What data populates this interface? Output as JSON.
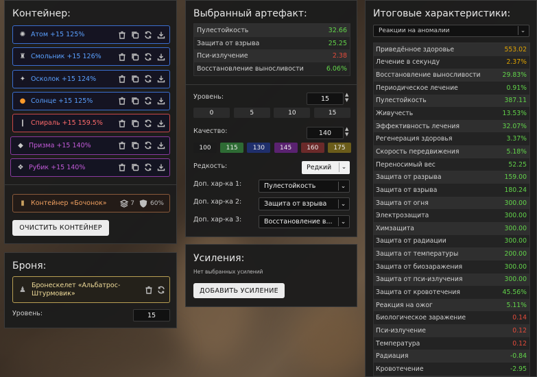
{
  "colors": {
    "green": "#62d44a",
    "orange": "#e0a400",
    "red": "#e34b3b",
    "white": "#ffffff"
  },
  "container": {
    "title": "Контейнер:",
    "artifacts": [
      {
        "name": "Атом +15 125%",
        "color": "#5aa0ff",
        "border": "#3b6fd1",
        "icon": "atom-icon",
        "glyph": "✺"
      },
      {
        "name": "Смольник +15 126%",
        "color": "#5aa0ff",
        "border": "#3b6fd1",
        "icon": "smolnik-icon",
        "glyph": "♜"
      },
      {
        "name": "Осколок +15 124%",
        "color": "#5aa0ff",
        "border": "#3b6fd1",
        "icon": "oskolok-icon",
        "glyph": "✦"
      },
      {
        "name": "Солнце +15 125%",
        "color": "#5aa0ff",
        "border": "#3b6fd1",
        "icon": "sun-icon",
        "glyph": "●"
      },
      {
        "name": "Спираль +15 159.5%",
        "color": "#ff6b6b",
        "border": "#c94848",
        "icon": "spiral-icon",
        "glyph": "❙"
      },
      {
        "name": "Призма +15 140%",
        "color": "#c15ad8",
        "border": "#8a3aa0",
        "icon": "prism-icon",
        "glyph": "◆"
      },
      {
        "name": "Рубик +15 140%",
        "color": "#c15ad8",
        "border": "#8a3aa0",
        "icon": "rubik-icon",
        "glyph": "❖"
      }
    ],
    "container_item": {
      "name": "Контейнер «Бочонок»",
      "slots": "7",
      "protection": "60%"
    },
    "clear_button": "ОЧИСТИТЬ КОНТЕЙНЕР"
  },
  "armor": {
    "title": "Броня:",
    "item_line1": "Бронескелет «Альбатрос-",
    "item_line2": "Штурмовик»",
    "level_label": "Уровень:",
    "level_value": "15"
  },
  "artifact": {
    "title": "Выбранный артефакт:",
    "stats": [
      {
        "name": "Пулестойкость",
        "value": "32.66",
        "color": "#62d44a"
      },
      {
        "name": "Защита от взрыва",
        "value": "25.25",
        "color": "#62d44a"
      },
      {
        "name": "Пси-излучение",
        "value": "2.38",
        "color": "#e34b3b"
      },
      {
        "name": "Восстановление выносливости",
        "value": "6.06%",
        "color": "#62d44a"
      }
    ],
    "level_label": "Уровень:",
    "level_value": "15",
    "level_presets": [
      "0",
      "5",
      "10",
      "15"
    ],
    "quality_label": "Качество:",
    "quality_value": "140",
    "quality_presets": [
      {
        "label": "100",
        "bg": "#1b1b1b"
      },
      {
        "label": "115",
        "bg": "#2e6b34"
      },
      {
        "label": "130",
        "bg": "#1f2f6b"
      },
      {
        "label": "145",
        "bg": "#5a2270"
      },
      {
        "label": "160",
        "bg": "#6b2a2a"
      },
      {
        "label": "175",
        "bg": "#6b5c1a"
      }
    ],
    "rarity_label": "Редкость:",
    "rarity_value": "Редкий",
    "extra1_label": "Доп. хар-ка 1:",
    "extra1_value": "Пулестойкость",
    "extra2_label": "Доп. хар-ка 2:",
    "extra2_value": "Защита от взрыва",
    "extra3_label": "Доп. хар-ка 3:",
    "extra3_value": "Восстановление в..."
  },
  "upgrades": {
    "title": "Усиления:",
    "empty_text": "Нет выбранных усилений",
    "add_button": "ДОБАВИТЬ УСИЛЕНИЕ"
  },
  "totals": {
    "title": "Итоговые характеристики:",
    "filter_value": "Реакции на аномалии",
    "rows": [
      {
        "name": "Приведённое здоровье",
        "value": "553.02",
        "color": "#e0a400"
      },
      {
        "name": "Лечение в секунду",
        "value": "2.37%",
        "color": "#e0a400"
      },
      {
        "name": "Восстановление выносливости",
        "value": "29.83%",
        "color": "#62d44a"
      },
      {
        "name": "Периодическое лечение",
        "value": "0.91%",
        "color": "#62d44a"
      },
      {
        "name": "Пулестойкость",
        "value": "387.11",
        "color": "#62d44a"
      },
      {
        "name": "Живучесть",
        "value": "13.53%",
        "color": "#62d44a"
      },
      {
        "name": "Эффективность лечения",
        "value": "32.07%",
        "color": "#62d44a"
      },
      {
        "name": "Регенерация здоровья",
        "value": "3.37%",
        "color": "#62d44a"
      },
      {
        "name": "Скорость передвижения",
        "value": "5.18%",
        "color": "#62d44a"
      },
      {
        "name": "Переносимый вес",
        "value": "52.25",
        "color": "#62d44a"
      },
      {
        "name": "Защита от разрыва",
        "value": "159.00",
        "color": "#62d44a"
      },
      {
        "name": "Защита от взрыва",
        "value": "180.24",
        "color": "#62d44a"
      },
      {
        "name": "Защита от огня",
        "value": "300.00",
        "color": "#62d44a"
      },
      {
        "name": "Электрозащита",
        "value": "300.00",
        "color": "#62d44a"
      },
      {
        "name": "Химзащита",
        "value": "300.00",
        "color": "#62d44a"
      },
      {
        "name": "Защита от радиации",
        "value": "300.00",
        "color": "#62d44a"
      },
      {
        "name": "Защита от температуры",
        "value": "200.00",
        "color": "#62d44a"
      },
      {
        "name": "Защита от биозаражения",
        "value": "300.00",
        "color": "#62d44a"
      },
      {
        "name": "Защита от пси-излучения",
        "value": "300.00",
        "color": "#62d44a"
      },
      {
        "name": "Защита от кровотечения",
        "value": "45.56%",
        "color": "#62d44a"
      },
      {
        "name": "Реакция на ожог",
        "value": "5.11%",
        "color": "#62d44a"
      },
      {
        "name": "Биологическое заражение",
        "value": "0.14",
        "color": "#e34b3b"
      },
      {
        "name": "Пси-излучение",
        "value": "0.12",
        "color": "#e34b3b"
      },
      {
        "name": "Температура",
        "value": "0.12",
        "color": "#e34b3b"
      },
      {
        "name": "Радиация",
        "value": "-0.84",
        "color": "#62d44a"
      },
      {
        "name": "Кровотечение",
        "value": "-2.95",
        "color": "#62d44a"
      }
    ]
  }
}
